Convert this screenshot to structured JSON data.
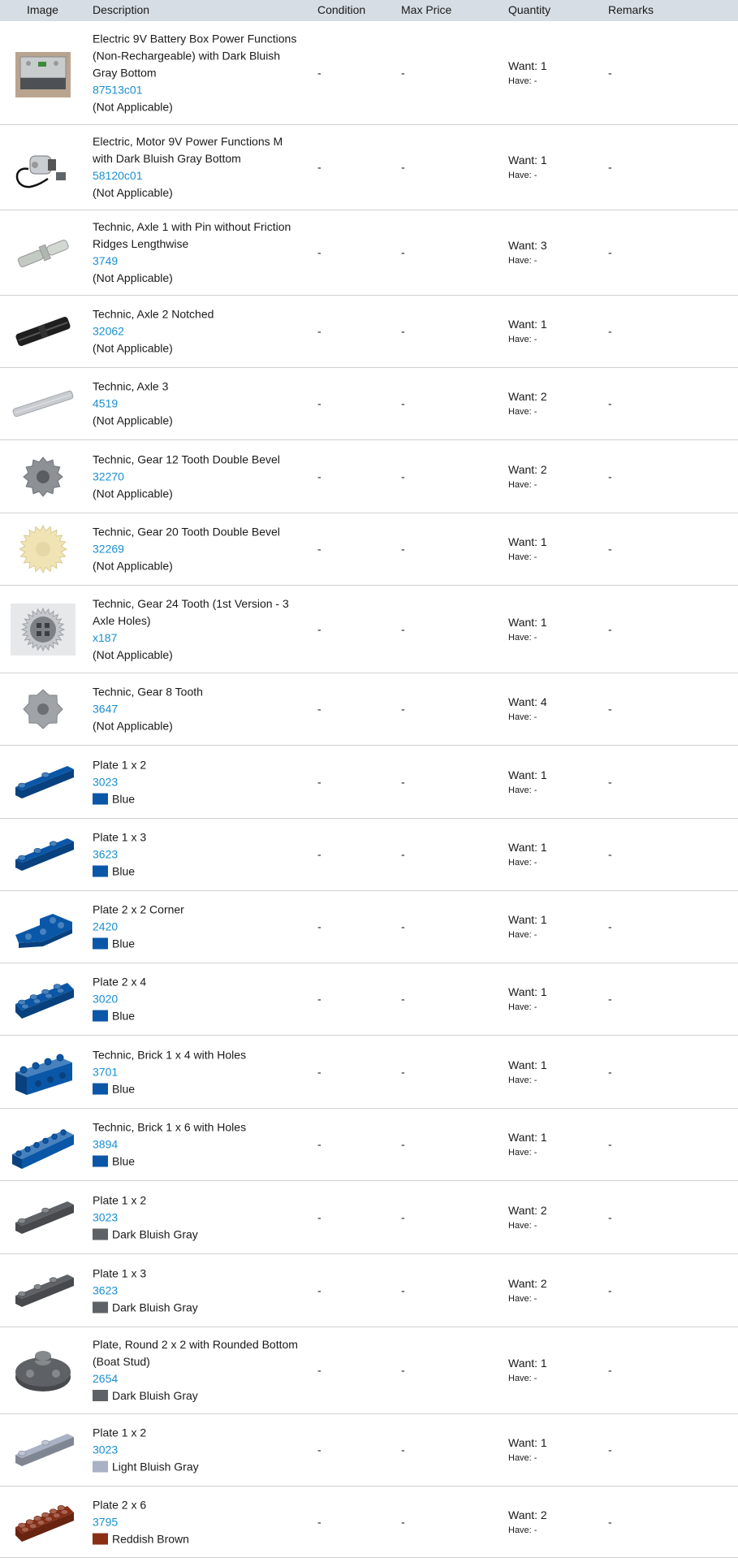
{
  "columns": {
    "image": "Image",
    "description": "Description",
    "condition": "Condition",
    "max_price": "Max Price",
    "quantity": "Quantity",
    "remarks": "Remarks"
  },
  "colors": {
    "header_bg": "#d6dde4",
    "link": "#1a8fd0",
    "Blue": "#0a57a8",
    "Dark Bluish Gray": "#5e6165",
    "Light Bluish Gray": "#a9b2c4",
    "Reddish Brown": "#8a2e16"
  },
  "rows": [
    {
      "name": "Electric 9V Battery Box Power Functions (Non-Rechargeable) with Dark Bluish Gray Bottom",
      "number": "87513c01",
      "color": "(Not Applicable)",
      "condition": "-",
      "max_price": "-",
      "want": "Want: 1",
      "have": "Have: -",
      "remarks": "-",
      "icon": "battery-box-icon"
    },
    {
      "name": "Electric, Motor 9V Power Functions M with Dark Bluish Gray Bottom",
      "number": "58120c01",
      "color": "(Not Applicable)",
      "condition": "-",
      "max_price": "-",
      "want": "Want: 1",
      "have": "Have: -",
      "remarks": "-",
      "icon": "motor-icon"
    },
    {
      "name": "Technic, Axle 1 with Pin without Friction Ridges Lengthwise",
      "number": "3749",
      "color": "(Not Applicable)",
      "condition": "-",
      "max_price": "-",
      "want": "Want: 3",
      "have": "Have: -",
      "remarks": "-",
      "icon": "axle-pin-icon"
    },
    {
      "name": "Technic, Axle 2 Notched",
      "number": "32062",
      "color": "(Not Applicable)",
      "condition": "-",
      "max_price": "-",
      "want": "Want: 1",
      "have": "Have: -",
      "remarks": "-",
      "icon": "axle-2-icon"
    },
    {
      "name": "Technic, Axle 3",
      "number": "4519",
      "color": "(Not Applicable)",
      "condition": "-",
      "max_price": "-",
      "want": "Want: 2",
      "have": "Have: -",
      "remarks": "-",
      "icon": "axle-3-icon"
    },
    {
      "name": "Technic, Gear 12 Tooth Double Bevel",
      "number": "32270",
      "color": "(Not Applicable)",
      "condition": "-",
      "max_price": "-",
      "want": "Want: 2",
      "have": "Have: -",
      "remarks": "-",
      "icon": "gear-12-icon"
    },
    {
      "name": "Technic, Gear 20 Tooth Double Bevel",
      "number": "32269",
      "color": "(Not Applicable)",
      "condition": "-",
      "max_price": "-",
      "want": "Want: 1",
      "have": "Have: -",
      "remarks": "-",
      "icon": "gear-20-icon"
    },
    {
      "name": "Technic, Gear 24 Tooth (1st Version - 3 Axle Holes)",
      "number": "x187",
      "color": "(Not Applicable)",
      "condition": "-",
      "max_price": "-",
      "want": "Want: 1",
      "have": "Have: -",
      "remarks": "-",
      "icon": "gear-24-icon"
    },
    {
      "name": "Technic, Gear 8 Tooth",
      "number": "3647",
      "color": "(Not Applicable)",
      "condition": "-",
      "max_price": "-",
      "want": "Want: 4",
      "have": "Have: -",
      "remarks": "-",
      "icon": "gear-8-icon"
    },
    {
      "name": "Plate 1 x 2",
      "number": "3023",
      "color": "Blue",
      "condition": "-",
      "max_price": "-",
      "want": "Want: 1",
      "have": "Have: -",
      "remarks": "-",
      "icon": "plate-1x2-icon"
    },
    {
      "name": "Plate 1 x 3",
      "number": "3623",
      "color": "Blue",
      "condition": "-",
      "max_price": "-",
      "want": "Want: 1",
      "have": "Have: -",
      "remarks": "-",
      "icon": "plate-1x3-icon"
    },
    {
      "name": "Plate 2 x 2 Corner",
      "number": "2420",
      "color": "Blue",
      "condition": "-",
      "max_price": "-",
      "want": "Want: 1",
      "have": "Have: -",
      "remarks": "-",
      "icon": "plate-corner-icon"
    },
    {
      "name": "Plate 2 x 4",
      "number": "3020",
      "color": "Blue",
      "condition": "-",
      "max_price": "-",
      "want": "Want: 1",
      "have": "Have: -",
      "remarks": "-",
      "icon": "plate-2x4-icon"
    },
    {
      "name": "Technic, Brick 1 x 4 with Holes",
      "number": "3701",
      "color": "Blue",
      "condition": "-",
      "max_price": "-",
      "want": "Want: 1",
      "have": "Have: -",
      "remarks": "-",
      "icon": "brick-1x4-icon"
    },
    {
      "name": "Technic, Brick 1 x 6 with Holes",
      "number": "3894",
      "color": "Blue",
      "condition": "-",
      "max_price": "-",
      "want": "Want: 1",
      "have": "Have: -",
      "remarks": "-",
      "icon": "brick-1x6-icon"
    },
    {
      "name": "Plate 1 x 2",
      "number": "3023",
      "color": "Dark Bluish Gray",
      "condition": "-",
      "max_price": "-",
      "want": "Want: 2",
      "have": "Have: -",
      "remarks": "-",
      "icon": "plate-1x2-icon"
    },
    {
      "name": "Plate 1 x 3",
      "number": "3623",
      "color": "Dark Bluish Gray",
      "condition": "-",
      "max_price": "-",
      "want": "Want: 2",
      "have": "Have: -",
      "remarks": "-",
      "icon": "plate-1x3-icon"
    },
    {
      "name": "Plate, Round 2 x 2 with Rounded Bottom (Boat Stud)",
      "number": "2654",
      "color": "Dark Bluish Gray",
      "condition": "-",
      "max_price": "-",
      "want": "Want: 1",
      "have": "Have: -",
      "remarks": "-",
      "icon": "round-plate-icon"
    },
    {
      "name": "Plate 1 x 2",
      "number": "3023",
      "color": "Light Bluish Gray",
      "condition": "-",
      "max_price": "-",
      "want": "Want: 1",
      "have": "Have: -",
      "remarks": "-",
      "icon": "plate-1x2-icon"
    },
    {
      "name": "Plate 2 x 6",
      "number": "3795",
      "color": "Reddish Brown",
      "condition": "-",
      "max_price": "-",
      "want": "Want: 2",
      "have": "Have: -",
      "remarks": "-",
      "icon": "plate-2x6-icon"
    }
  ]
}
